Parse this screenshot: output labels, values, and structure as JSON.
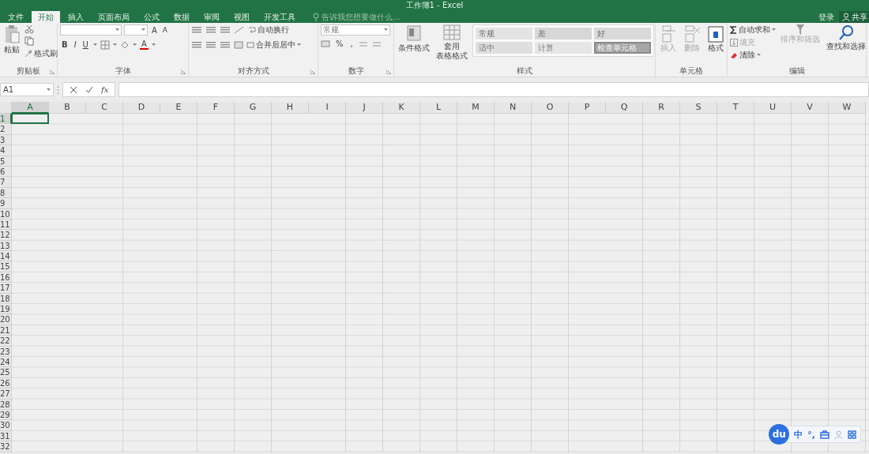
{
  "window": {
    "title": "工作簿1 - Excel"
  },
  "tabs": [
    {
      "label": "文件",
      "selected": false
    },
    {
      "label": "开始",
      "selected": true
    },
    {
      "label": "插入",
      "selected": false
    },
    {
      "label": "页面布局",
      "selected": false
    },
    {
      "label": "公式",
      "selected": false
    },
    {
      "label": "数据",
      "selected": false
    },
    {
      "label": "审阅",
      "selected": false
    },
    {
      "label": "视图",
      "selected": false
    },
    {
      "label": "开发工具",
      "selected": false
    }
  ],
  "tell_me": {
    "placeholder": "告诉我您想要做什么..."
  },
  "account": {
    "sign_in": "登录",
    "share": "共享"
  },
  "ribbon": {
    "groups": [
      {
        "kind": "clipboard",
        "label": "剪贴板",
        "paste": "粘贴",
        "format_painter": "格式刷"
      },
      {
        "kind": "font",
        "label": "字体",
        "grow": "A",
        "shrink": "A",
        "bold": "B",
        "italic": "I",
        "underline": "U",
        "font_color": "A"
      },
      {
        "kind": "alignment",
        "label": "对齐方式",
        "wrap": "自动换行",
        "merge": "合并后居中"
      },
      {
        "kind": "number",
        "label": "数字",
        "format": "常规",
        "percent": "%",
        "comma": ","
      },
      {
        "kind": "styles",
        "label": "样式",
        "conditional": "条件格式",
        "table": [
          "套用",
          "表格格式"
        ],
        "gallery": [
          {
            "label": "常规",
            "kind": "normal"
          },
          {
            "label": "差",
            "kind": "bad"
          },
          {
            "label": "好",
            "kind": "good"
          },
          {
            "label": "适中",
            "kind": "neutral"
          },
          {
            "label": "计算",
            "kind": "calc"
          },
          {
            "label": "检查单元格",
            "kind": "check"
          }
        ]
      },
      {
        "kind": "cells",
        "label": "单元格",
        "buttons": [
          {
            "label": "插入",
            "disabled": true
          },
          {
            "label": "删除",
            "disabled": true
          },
          {
            "label": "格式",
            "disabled": false
          }
        ]
      },
      {
        "kind": "editing",
        "label": "编辑",
        "autosum": "自动求和",
        "fill": {
          "label": "填充",
          "disabled": true
        },
        "clear": "清除",
        "sort": {
          "label": "排序和筛选",
          "disabled": true
        },
        "find": {
          "label": "查找和选择",
          "disabled": false
        }
      }
    ]
  },
  "formula_bar": {
    "name_box": "A1",
    "function_label": "fx"
  },
  "sheet": {
    "columns": [
      {
        "label": "A",
        "selected": true
      },
      {
        "label": "B",
        "selected": false
      },
      {
        "label": "C",
        "selected": false
      },
      {
        "label": "D",
        "selected": false
      },
      {
        "label": "E",
        "selected": false
      },
      {
        "label": "F",
        "selected": false
      },
      {
        "label": "G",
        "selected": false
      },
      {
        "label": "H",
        "selected": false
      },
      {
        "label": "I",
        "selected": false
      },
      {
        "label": "J",
        "selected": false
      },
      {
        "label": "K",
        "selected": false
      },
      {
        "label": "L",
        "selected": false
      },
      {
        "label": "M",
        "selected": false
      },
      {
        "label": "N",
        "selected": false
      },
      {
        "label": "O",
        "selected": false
      },
      {
        "label": "P",
        "selected": false
      },
      {
        "label": "Q",
        "selected": false
      },
      {
        "label": "R",
        "selected": false
      },
      {
        "label": "S",
        "selected": false
      },
      {
        "label": "T",
        "selected": false
      },
      {
        "label": "U",
        "selected": false
      },
      {
        "label": "V",
        "selected": false
      },
      {
        "label": "W",
        "selected": false
      }
    ],
    "rows": [
      {
        "label": "1",
        "selected": true
      },
      {
        "label": "2",
        "selected": false
      },
      {
        "label": "3",
        "selected": false
      },
      {
        "label": "4",
        "selected": false
      },
      {
        "label": "5",
        "selected": false
      },
      {
        "label": "6",
        "selected": false
      },
      {
        "label": "7",
        "selected": false
      },
      {
        "label": "8",
        "selected": false
      },
      {
        "label": "9",
        "selected": false
      },
      {
        "label": "10",
        "selected": false
      },
      {
        "label": "11",
        "selected": false
      },
      {
        "label": "12",
        "selected": false
      },
      {
        "label": "13",
        "selected": false
      },
      {
        "label": "14",
        "selected": false
      },
      {
        "label": "15",
        "selected": false
      },
      {
        "label": "16",
        "selected": false
      },
      {
        "label": "17",
        "selected": false
      },
      {
        "label": "18",
        "selected": false
      },
      {
        "label": "19",
        "selected": false
      },
      {
        "label": "20",
        "selected": false
      },
      {
        "label": "21",
        "selected": false
      },
      {
        "label": "22",
        "selected": false
      },
      {
        "label": "23",
        "selected": false
      },
      {
        "label": "24",
        "selected": false
      },
      {
        "label": "25",
        "selected": false
      },
      {
        "label": "26",
        "selected": false
      },
      {
        "label": "27",
        "selected": false
      },
      {
        "label": "28",
        "selected": false
      },
      {
        "label": "29",
        "selected": false
      },
      {
        "label": "30",
        "selected": false
      },
      {
        "label": "31",
        "selected": false
      },
      {
        "label": "32",
        "selected": false
      }
    ]
  },
  "ime": {
    "logo": "du",
    "mode": "中",
    "punctuation": "°,"
  }
}
